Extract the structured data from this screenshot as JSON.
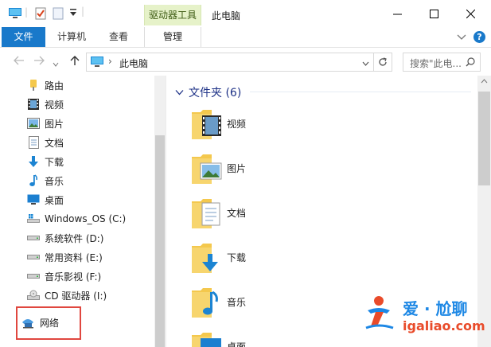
{
  "titlebar": {
    "context_tab_header": "驱动器工具",
    "title": "此电脑",
    "minimize_glyph": "─",
    "maximize_glyph": "☐",
    "close_glyph": "✕"
  },
  "ribbon": {
    "tabs": [
      "文件",
      "计算机",
      "查看",
      "管理"
    ],
    "help_glyph": "?"
  },
  "navbar": {
    "breadcrumb_sep": "›",
    "location": "此电脑",
    "search_placeholder": "搜索\"此电..."
  },
  "navpane": {
    "items": [
      {
        "label": "路由",
        "icon": "pin-folder-icon"
      },
      {
        "label": "视频",
        "icon": "video-icon"
      },
      {
        "label": "图片",
        "icon": "pictures-icon"
      },
      {
        "label": "文档",
        "icon": "documents-icon"
      },
      {
        "label": "下载",
        "icon": "download-icon"
      },
      {
        "label": "音乐",
        "icon": "music-icon"
      },
      {
        "label": "桌面",
        "icon": "desktop-icon"
      },
      {
        "label": "Windows_OS (C:)",
        "icon": "windows-drive-icon"
      },
      {
        "label": "系统软件 (D:)",
        "icon": "drive-icon"
      },
      {
        "label": "常用资料 (E:)",
        "icon": "drive-icon"
      },
      {
        "label": "音乐影视 (F:)",
        "icon": "drive-icon"
      },
      {
        "label": "CD 驱动器 (I:)",
        "icon": "cd-drive-icon"
      }
    ],
    "network": {
      "label": "网络",
      "icon": "network-icon"
    }
  },
  "content": {
    "group_header": "文件夹 (6)",
    "folders": [
      "视频",
      "图片",
      "文档",
      "下载",
      "音乐",
      "桌面"
    ]
  },
  "watermark": {
    "line1": "爱 · 尬聊",
    "line2": "igaliao.com"
  },
  "colors": {
    "accent": "#1979ca",
    "context_tab": "#e6f2c9",
    "group_header": "#1e3287",
    "highlight_box": "#e0473f",
    "folder_yellow": "#f4c84d"
  }
}
